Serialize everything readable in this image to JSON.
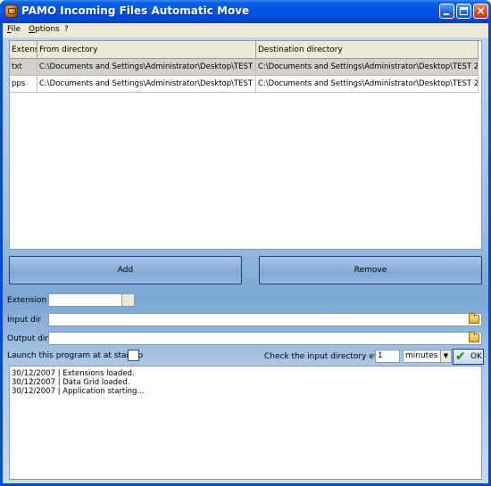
{
  "window": {
    "title": "PAMO Incoming Files Automatic Move",
    "min_glyph": "",
    "max_glyph": "",
    "close_glyph": "×"
  },
  "menu": {
    "items": [
      "File",
      "Options",
      "?"
    ]
  },
  "grid": {
    "columns": [
      "Extension",
      "From directory",
      "Destination directory"
    ],
    "rows": [
      {
        "extension": "txt",
        "from": "C:\\Documents and Settings\\Administrator\\Desktop\\TEST",
        "destination": "C:\\Documents and Settings\\Administrator\\Desktop\\TEST 2",
        "selected": true
      },
      {
        "extension": "pps",
        "from": "C:\\Documents and Settings\\Administrator\\Desktop\\TEST",
        "destination": "C:\\Documents and Settings\\Administrator\\Desktop\\TEST 2",
        "selected": false
      }
    ]
  },
  "buttons": {
    "add": "Add",
    "remove": "Remove",
    "ok": "OK"
  },
  "form": {
    "extension_label": "Extension",
    "extension_value": "",
    "input_dir_label": "Input dir",
    "input_dir_value": "",
    "output_dir_label": "Output dir",
    "output_dir_value": "",
    "startup_label": "Launch this program at at startup",
    "startup_checked": false,
    "check_label": "Check the input directory every :",
    "interval_value": "1",
    "interval_unit": "minutes"
  },
  "log": {
    "lines": [
      "30/12/2007 | Extensions loaded.",
      "30/12/2007 | Data Grid loaded.",
      "30/12/2007 | Application starting..."
    ]
  },
  "colors": {
    "titlebar": "#0055e5",
    "client_background": "#9ebedd",
    "selected_row": "#d4d0c8"
  }
}
